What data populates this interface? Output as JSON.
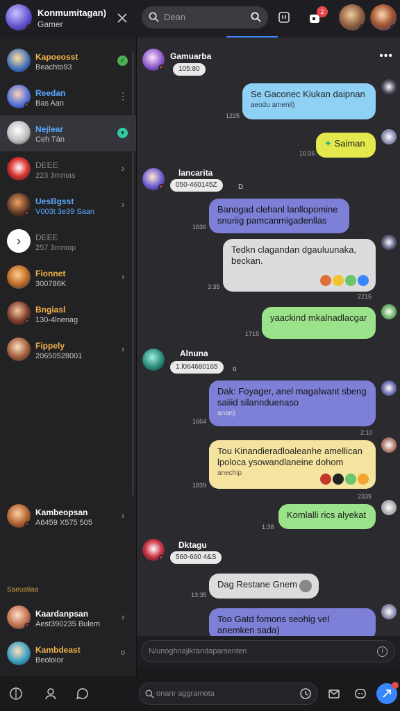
{
  "header": {
    "title": "Konmumitagan)",
    "subtitle": "Gamer",
    "search_placeholder": "Dean",
    "notif_count": "2"
  },
  "contacts": [
    {
      "name": "Kapoeosst",
      "sub": "Beachto93",
      "name_color": "#f0b24a",
      "right": "dot",
      "dot_color": "#4caf50",
      "dot_text": "✓"
    },
    {
      "name": "Reedan",
      "sub": "Bas Aan",
      "name_color": "#5aa8ff",
      "right": "kebab"
    },
    {
      "name": "Nejlear",
      "sub": "Ceh Tán",
      "name_color": "#5aa8ff",
      "right": "dot",
      "dot_color": "#35c7a4",
      "dot_text": "▾",
      "selected": true
    },
    {
      "name": "DEEE",
      "sub": "223 3mmas",
      "name_color": "#888888",
      "right": "chevron"
    },
    {
      "name": "UesBgsst",
      "sub": "V003t 3e39 Saan",
      "name_color": "#5aa8ff",
      "right": "chevron"
    },
    {
      "name": "DEEE",
      "sub": "257 3mmop",
      "name_color": "#888888",
      "right": ""
    },
    {
      "name": "Fionnet",
      "sub": "300786K",
      "name_color": "#f0b24a",
      "right": "chevron"
    },
    {
      "name": "Bngiasl",
      "sub": "130-4lnenag",
      "name_color": "#f0b24a",
      "right": ""
    },
    {
      "name": "Fippely",
      "sub": "20650528001",
      "name_color": "#f0b24a",
      "right": "chevron"
    },
    {
      "name": "Kambeopsan",
      "sub": "A6459 X575 505",
      "name_color": "#ffffff",
      "right": "chevron"
    }
  ],
  "section_label": "Saeuatiaa",
  "bottom_contacts": [
    {
      "name": "Kaardanpsan",
      "sub": "Aest390235 Bulem",
      "name_color": "#ffffff",
      "right": "chevron"
    },
    {
      "name": "Kambdeast",
      "sub": "Beoloior",
      "name_color": "#f0b24a",
      "right": "o"
    }
  ],
  "chat": {
    "messages": [
      {
        "kind": "sender",
        "name": "Gamuarba",
        "meta": "105:80"
      },
      {
        "kind": "out",
        "text": "Se Gaconec Kiukan daipnan",
        "sub": "aeodu amenil)",
        "time": "1225",
        "color": "#8fd0f5"
      },
      {
        "kind": "out",
        "text": "Saiman",
        "time": "16:36",
        "color": "#e3e84c"
      },
      {
        "kind": "sender",
        "name": "lancarita",
        "meta": "050-460145Z",
        "suffix": "D"
      },
      {
        "kind": "out",
        "text": "Banogad clehanl lanllopomine snuriig pamcanmigadenllas",
        "time": "1636",
        "color": "#7e7fd6"
      },
      {
        "kind": "in",
        "text": "Tedkn clagandan dgauluunaka, beckan.",
        "time": "3:35",
        "time2": "2216",
        "color": "#dcdcdc"
      },
      {
        "kind": "out",
        "text": "yaackind mkalnadlacgar",
        "time": "1715",
        "color": "#9be38a"
      },
      {
        "kind": "sender",
        "name": "Alnuna",
        "meta": "1.l064680165",
        "suffix": "o"
      },
      {
        "kind": "out",
        "text": "Dak: Foyager, anel magalwant sbeng saiiid silannduenaso",
        "sub": "anan)",
        "time": "1664",
        "time2": "2:10",
        "color": "#7e7fd6"
      },
      {
        "kind": "out",
        "text": "Tou Kinandieradloaleanhe amellican lpoloca ysowandlaneine dohom",
        "sub": "anechip",
        "time": "1839",
        "time2": "2339",
        "color": "#f5e4a0"
      },
      {
        "kind": "out",
        "text": "Komlalli rics alyekat",
        "time": "1:38",
        "color": "#9be38a"
      },
      {
        "kind": "sender",
        "name": "Dktagu",
        "meta": "560-660 4&S"
      },
      {
        "kind": "in",
        "text": "Dag Restane Gnem",
        "time": "13:35",
        "color": "#dcdcdc"
      },
      {
        "kind": "out",
        "text": "Too Gatd fomons seohig vel anemken sada)",
        "color": "#7e7fd6"
      }
    ],
    "composer_placeholder": "N/unoghnajikrandaparsenten",
    "bottom_search_placeholder": "onanr aggramota"
  },
  "colors": {
    "accent": "#3a86ff",
    "bg": "#2b2b2f",
    "sidebar": "#222225"
  }
}
